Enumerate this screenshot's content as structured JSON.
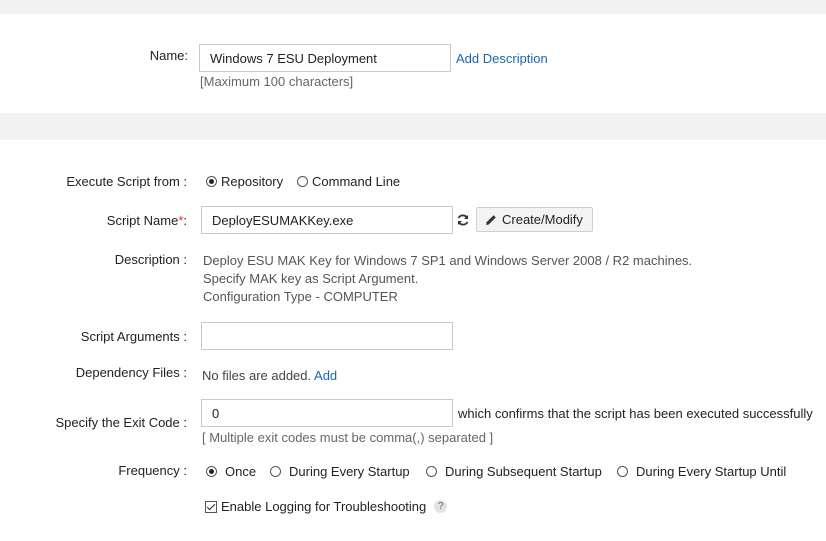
{
  "name_section": {
    "label": "Name:",
    "value": "Windows 7 ESU Deployment",
    "add_description": "Add Description",
    "hint": "[Maximum 100 characters]"
  },
  "form": {
    "execute_from": {
      "label": "Execute Script from :",
      "options": [
        "Repository",
        "Command Line"
      ],
      "selected": "Repository"
    },
    "script_name": {
      "label": "Script Name",
      "required_marker": "*",
      "colon": ":",
      "value": "DeployESUMAKKey.exe",
      "refresh_icon": "refresh-icon",
      "create_modify": "Create/Modify",
      "pencil_icon": "pencil-icon"
    },
    "description": {
      "label": "Description :",
      "lines": [
        "Deploy ESU MAK Key for Windows 7 SP1 and Windows Server 2008 / R2 machines.",
        "Specify MAK key as Script Argument.",
        "Configuration Type - COMPUTER"
      ]
    },
    "script_arguments": {
      "label": "Script Arguments :",
      "value": ""
    },
    "dependency_files": {
      "label": "Dependency Files :",
      "text": "No files are added.",
      "add": "Add"
    },
    "exit_code": {
      "label": "Specify the Exit Code :",
      "value": "0",
      "suffix": "which confirms that the script has been executed successfully",
      "hint": "[ Multiple exit codes must be comma(,) separated ]"
    },
    "frequency": {
      "label": "Frequency :",
      "options": [
        "Once",
        "During Every Startup",
        "During Subsequent Startup",
        "During Every Startup Until"
      ],
      "selected": "Once"
    },
    "logging": {
      "label": "Enable Logging for Troubleshooting",
      "checked": true,
      "help": "?"
    }
  },
  "colors": {
    "link": "#1a66b3",
    "required": "#d9342b",
    "band": "#f2f2f2"
  }
}
